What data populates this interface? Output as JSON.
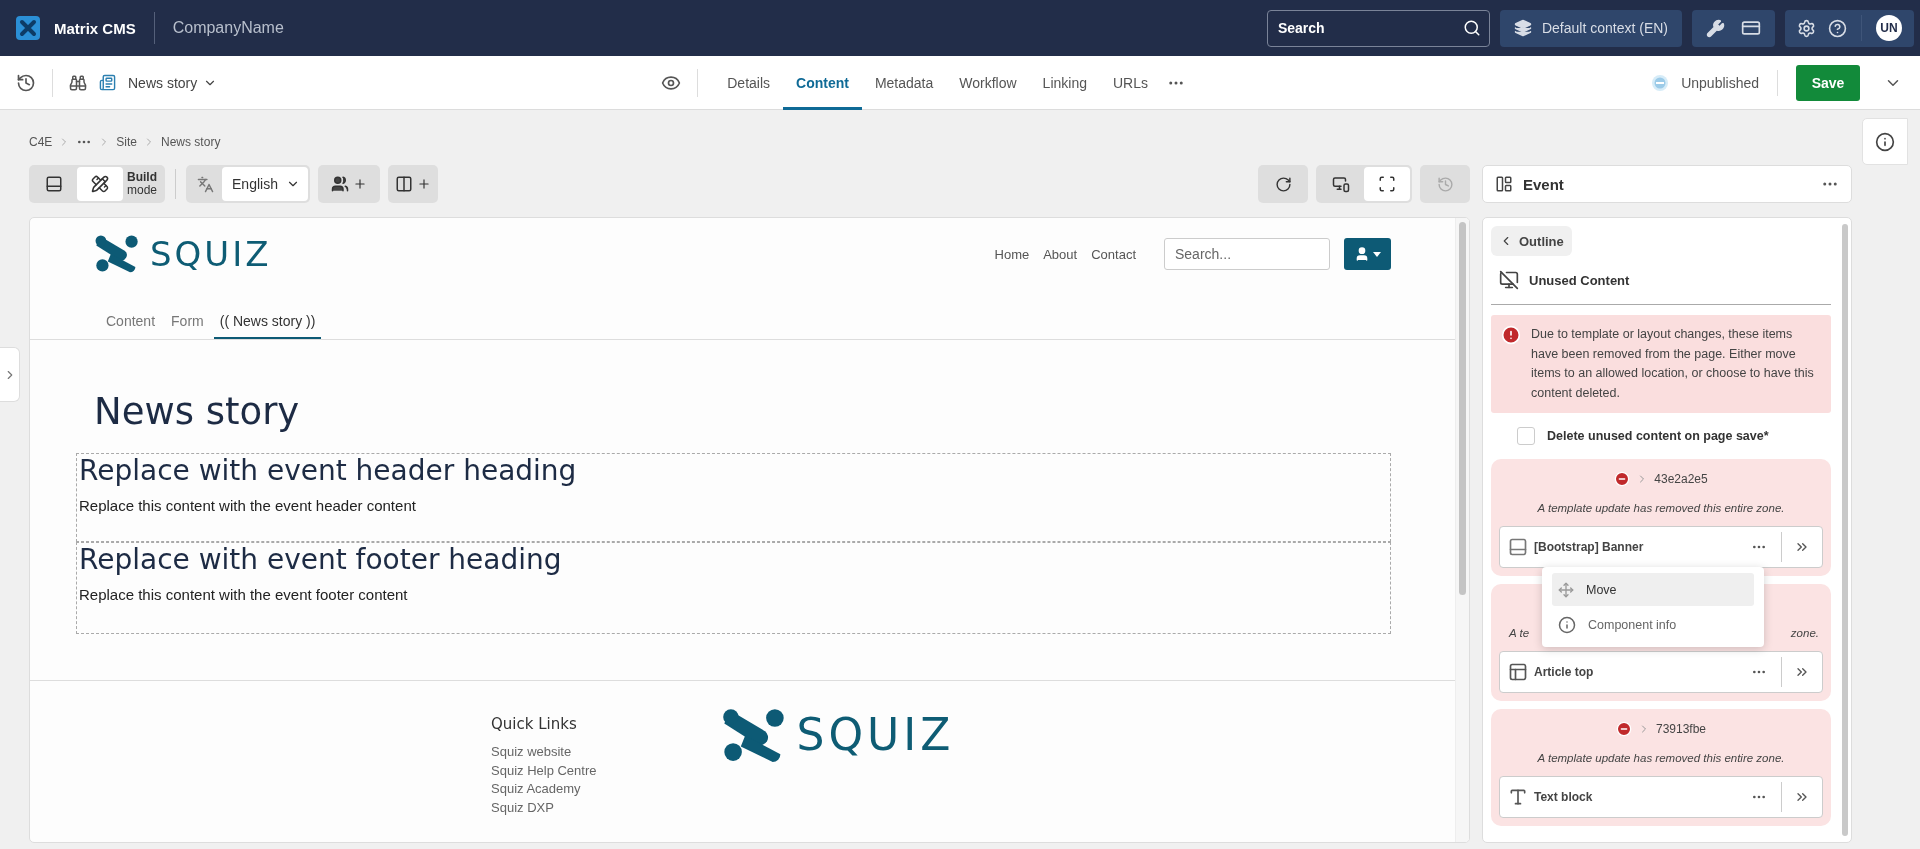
{
  "topbar": {
    "product": "Matrix CMS",
    "company": "CompanyName",
    "search": {
      "placeholder": "Search"
    },
    "context": "Default context (EN)",
    "avatar": "UN"
  },
  "toolbar": {
    "asset": "News story",
    "tabs": [
      {
        "label": "Details",
        "selected": false
      },
      {
        "label": "Content",
        "selected": true
      },
      {
        "label": "Metadata",
        "selected": false
      },
      {
        "label": "Workflow",
        "selected": false
      },
      {
        "label": "Linking",
        "selected": false
      },
      {
        "label": "URLs",
        "selected": false
      }
    ],
    "status": "Unpublished",
    "save": "Save"
  },
  "breadcrumb": [
    {
      "kind": "link",
      "label": "C4E"
    },
    {
      "kind": "ellipsis"
    },
    {
      "kind": "link",
      "label": "Site"
    },
    {
      "kind": "current",
      "label": "News story"
    }
  ],
  "builder": {
    "modes": [
      {
        "kind": "preview",
        "selected": false
      },
      {
        "kind": "build",
        "selected": true
      }
    ],
    "mode_label": "Build",
    "mode_sublabel": "mode",
    "language": "English",
    "views": [
      {
        "kind": "devices",
        "selected": false
      },
      {
        "kind": "fullscreen",
        "selected": true
      }
    ],
    "history": {
      "disabled": true
    },
    "panel_title": "Event"
  },
  "site": {
    "logo": "SQUIZ",
    "nav": [
      "Home",
      "About",
      "Contact"
    ],
    "search": {
      "placeholder": "Search..."
    },
    "tabs": [
      {
        "label": "Content",
        "selected": false
      },
      {
        "label": "Form",
        "selected": false
      },
      {
        "label": "(( News story ))",
        "selected": true
      }
    ],
    "title": "News story",
    "blocks": [
      {
        "heading": "Replace with event header heading",
        "text": "Replace this content with the event header content"
      },
      {
        "heading": "Replace with event footer heading",
        "text": "Replace this content with the event footer content"
      }
    ],
    "footer": {
      "heading": "Quick Links",
      "links": [
        "Squiz website",
        "Squiz Help Centre",
        "Squiz Academy",
        "Squiz DXP"
      ],
      "logo": "SQUIZ"
    }
  },
  "panel": {
    "back": "Outline",
    "section": "Unused Content",
    "alert": "Due to template or layout changes, these items have been removed from the page. Either move items to an allowed location, or choose to have this content deleted.",
    "delete_option": {
      "label": "Delete unused content on page save*",
      "checked": false
    },
    "zones": [
      {
        "id": "43e2a2e5",
        "note": "A template update has removed this entire zone.",
        "component": {
          "kind": "banner",
          "name": "[Bootstrap] Banner",
          "menu": [
            {
              "kind": "move",
              "label": "Move",
              "selected": true
            },
            {
              "kind": "info",
              "label": "Component info",
              "selected": false
            }
          ]
        }
      },
      {
        "note_fragments": [
          "A te",
          "zone."
        ],
        "component": {
          "kind": "layout",
          "name": "Article top"
        }
      },
      {
        "id": "73913fbe",
        "note": "A template update has removed this entire zone.",
        "component": {
          "kind": "text",
          "name": "Text block"
        }
      }
    ]
  }
}
